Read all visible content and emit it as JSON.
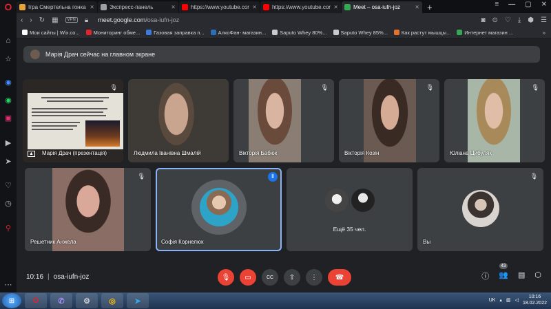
{
  "browser": {
    "tabs": [
      {
        "title": "Ігра Смертельна гонка он",
        "color": "#e8a33a",
        "active": false
      },
      {
        "title": "Экспресс-панель",
        "color": "#9aa0a6",
        "active": false
      },
      {
        "title": "https://www.youtube.com/",
        "color": "#ff0000",
        "active": false
      },
      {
        "title": "https://www.youtube.com/",
        "color": "#ff0000",
        "active": false
      },
      {
        "title": "Meet – osa-iufn-joz",
        "color": "#34a853",
        "active": true
      }
    ],
    "close_glyph": "✕",
    "new_tab": "+",
    "address": {
      "vpn": "VPN",
      "host": "meet.google.com",
      "path": "/osa-iufn-joz"
    },
    "bookmarks": [
      {
        "label": "Мои сайты | Wix.co...",
        "color": "#ffffff"
      },
      {
        "label": "Мониторинг обме...",
        "color": "#e0232d"
      },
      {
        "label": "Газовая заправка п...",
        "color": "#3d7bd9"
      },
      {
        "label": "АлкоФан- магазин...",
        "color": "#2a6fb8"
      },
      {
        "label": "Saputo Whey 80%...",
        "color": "#c9cacd"
      },
      {
        "label": "Saputo Whey 85%...",
        "color": "#c9cacd"
      },
      {
        "label": "Как растут мышцы...",
        "color": "#e0732d"
      },
      {
        "label": "Интернет магазин ...",
        "color": "#34a853"
      }
    ],
    "bookmarks_more": "»"
  },
  "meet": {
    "presenter_notice": "Марія Драч сейчас на главном экране",
    "tiles": [
      {
        "name": "Марія Драч (презентація)",
        "muted": true,
        "photo": "#2b2724",
        "skin": "#e4e1d9"
      },
      {
        "name": "Людмила Іванівна Шмалій",
        "muted": false,
        "photo": "#3e3a36",
        "skin": "#c9a48e"
      },
      {
        "name": "Вікторія Бабюк",
        "muted": true,
        "photo": "#8a7e74",
        "skin": "#d9b4a0"
      },
      {
        "name": "Вікторія Козін",
        "muted": true,
        "photo": "#6a5a52",
        "skin": "#d6ab95"
      },
      {
        "name": "Юліана Цибуляк",
        "muted": true,
        "photo": "#a8b6a8",
        "skin": "#e0bda7"
      },
      {
        "name": "Решетник Анжела",
        "muted": true,
        "photo": "#8a6e66",
        "skin": "#d9a898"
      },
      {
        "name": "Софія Корнелюк",
        "muted": false,
        "speaking": true
      },
      {
        "name": "",
        "more_label": "Ещё 35 чел."
      },
      {
        "name": "Вы",
        "muted": true
      }
    ],
    "mic_glyph": "🎙︎",
    "speak_glyph": "⦀",
    "time": "10:16",
    "code": "osa-iufn-joz",
    "participants_count": "43",
    "controls": {
      "mic": "🎙︎",
      "cam": "▭",
      "captions": "CC",
      "present": "⇧",
      "more": "⋮",
      "end": "☎"
    },
    "right_controls": {
      "info": "ⓘ",
      "people": "👥",
      "chat": "▤",
      "activities": "⬡"
    }
  },
  "taskbar": {
    "start": "⊞",
    "lang": "UK",
    "time": "10:16",
    "date": "18.02.2022"
  }
}
